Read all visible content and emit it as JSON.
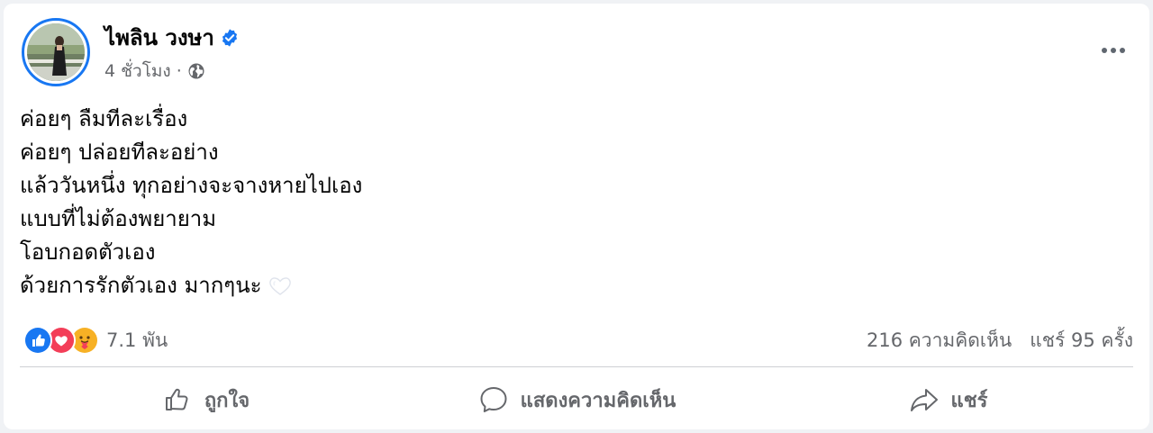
{
  "post": {
    "author": {
      "name": "ไพลิน วงษา",
      "verified": true,
      "avatar": "avatar-photo"
    },
    "meta": {
      "time": "4 ชั่วโมง",
      "separator": "·",
      "privacy_icon": "globe-icon"
    },
    "more_icon": "more-options-icon",
    "text_lines": [
      "ค่อยๆ ลืมทีละเรื่อง",
      "ค่อยๆ ปล่อยทีละอย่าง",
      "แล้ววันหนึ่ง ทุกอย่างจะจางหายไปเอง",
      "แบบที่ไม่ต้องพยายาม",
      "โอบกอดตัวเอง",
      "ด้วยการรักตัวเอง มากๆนะ"
    ],
    "text_trailing_emoji": "white-heart-emoji",
    "reactions": {
      "icons": [
        "like-reaction-icon",
        "love-reaction-icon",
        "care-reaction-icon"
      ],
      "count": "7.1 พัน"
    },
    "comments": "216 ความคิดเห็น",
    "shares": "แชร์ 95 ครั้ง"
  },
  "actions": {
    "like": {
      "label": "ถูกใจ",
      "icon": "thumbs-up-icon"
    },
    "comment": {
      "label": "แสดงความคิดเห็น",
      "icon": "comment-bubble-icon"
    },
    "share": {
      "label": "แชร์",
      "icon": "share-arrow-icon"
    }
  },
  "colors": {
    "brand_blue": "#1877f2",
    "secondary_text": "#65676b",
    "love_red": "#f33e58",
    "care_yellow": "#f7b125",
    "divider": "#ced0d4"
  }
}
